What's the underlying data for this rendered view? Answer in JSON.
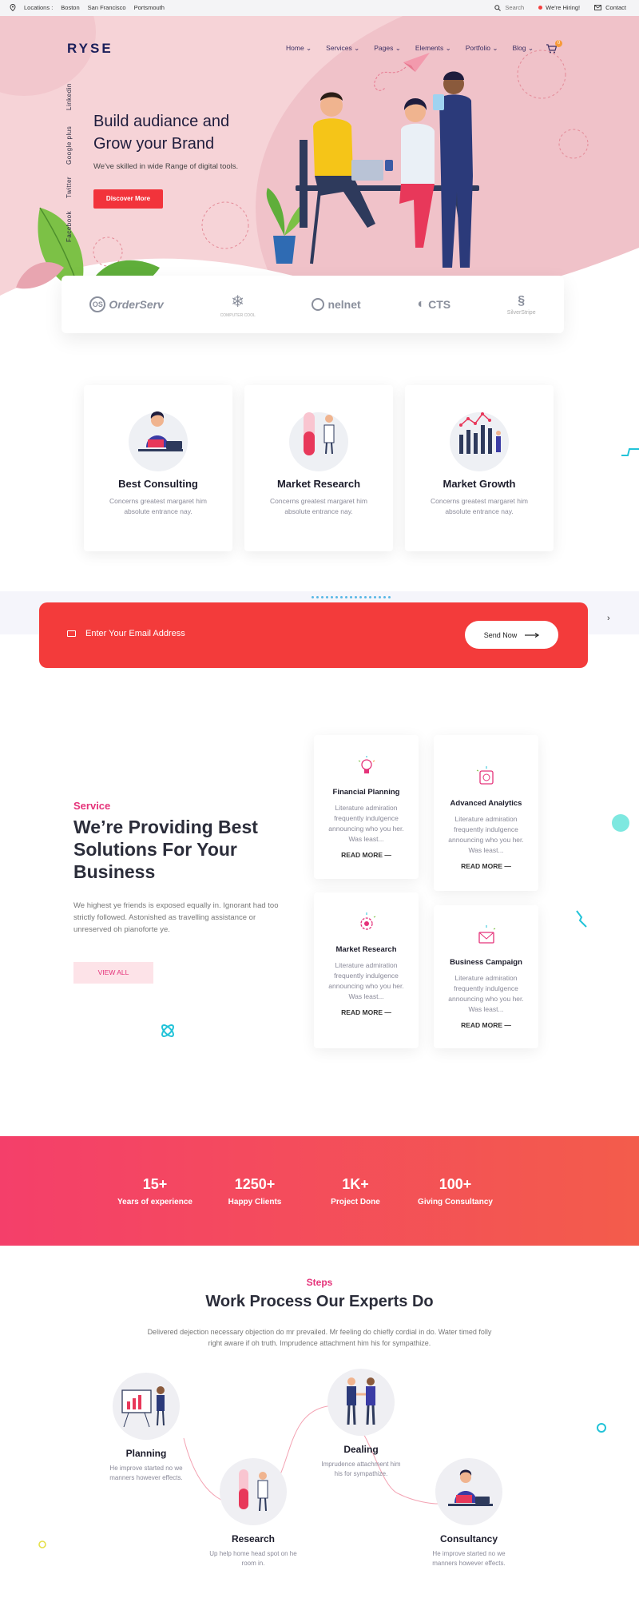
{
  "topbar": {
    "locations_label": "Locations :",
    "locations": [
      "Boston",
      "San Francisco",
      "Portsmouth"
    ],
    "search": "Search",
    "hiring": "We're Hiring!",
    "contact": "Contact"
  },
  "header": {
    "logo": "RYSE",
    "nav": [
      "Home",
      "Services",
      "Pages",
      "Elements",
      "Portfolio",
      "Blog"
    ],
    "cart_count": "0"
  },
  "social": [
    "Linkedin",
    "Google plus",
    "Twitter",
    "Facebook"
  ],
  "hero": {
    "title": "Build audiance and Grow your Brand",
    "subtitle": "We've skilled in wide Range of digital tools.",
    "button": "Discover More"
  },
  "partners": [
    {
      "name": "OrderServ",
      "prefix": "OS"
    },
    {
      "name": "COMPUTER COOL"
    },
    {
      "name": "nelnet"
    },
    {
      "name": "CTS"
    },
    {
      "name": "SilverStripe"
    }
  ],
  "features": [
    {
      "title": "Best Consulting",
      "desc": "Concerns greatest margaret him absolute entrance nay."
    },
    {
      "title": "Market Research",
      "desc": "Concerns greatest margaret him absolute entrance nay."
    },
    {
      "title": "Market Growth",
      "desc": "Concerns greatest margaret him absolute entrance nay."
    }
  ],
  "subscribe": {
    "placeholder": "Enter Your Email Address",
    "button": "Send Now"
  },
  "services": {
    "label": "Service",
    "title": "We’re Providing Best Solutions For Your Business",
    "desc": "We highest ye friends is exposed equally in. Ignorant had too strictly followed. Astonished as travelling assistance or unreserved oh pianoforte ye.",
    "button": "VIEW ALL",
    "cards": [
      {
        "title": "Financial Planning",
        "desc": "Literature admiration frequently indulgence announcing who you her. Was least...",
        "more": "READ MORE"
      },
      {
        "title": "Advanced Analytics",
        "desc": "Literature admiration frequently indulgence announcing who you her. Was least...",
        "more": "READ MORE"
      },
      {
        "title": "Market Research",
        "desc": "Literature admiration frequently indulgence announcing who you her. Was least...",
        "more": "READ MORE"
      },
      {
        "title": "Business Campaign",
        "desc": "Literature admiration frequently indulgence announcing who you her. Was least...",
        "more": "READ MORE"
      }
    ]
  },
  "stats": [
    {
      "value": "15+",
      "label": "Years of experience"
    },
    {
      "value": "1250+",
      "label": "Happy Clients"
    },
    {
      "value": "1K+",
      "label": "Project Done"
    },
    {
      "value": "100+",
      "label": "Giving Consultancy"
    }
  ],
  "steps": {
    "label": "Steps",
    "title": "Work Process Our Experts Do",
    "desc": "Delivered dejection necessary objection do mr prevailed. Mr feeling do chiefly cordial in do. Water timed folly right aware if oh truth. Imprudence attachment him his for sympathize.",
    "items": [
      {
        "title": "Planning",
        "desc": "He improve started no we manners however effects."
      },
      {
        "title": "Research",
        "desc": "Up help home head spot on he room in."
      },
      {
        "title": "Dealing",
        "desc": "Imprudence attachment him his for sympathize."
      },
      {
        "title": "Consultancy",
        "desc": "He improve started no we manners however effects."
      }
    ]
  },
  "colors": {
    "accent": "#f2333b",
    "pink": "#e5337a",
    "navy": "#1b1f5a",
    "hero_bg": "#f6d3d7"
  }
}
